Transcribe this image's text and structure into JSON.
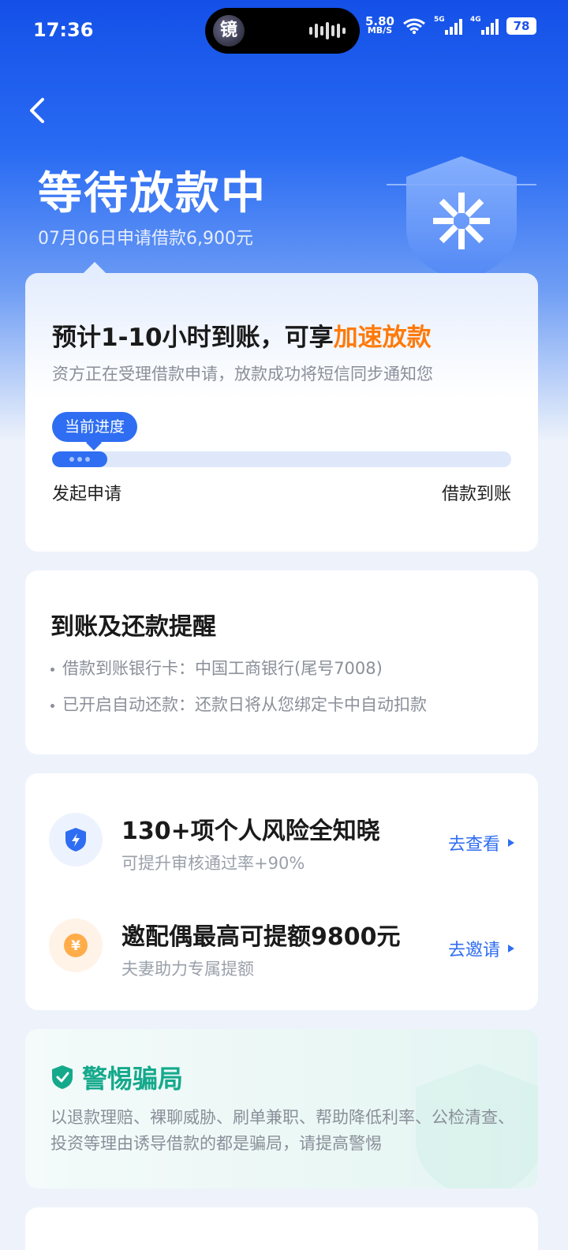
{
  "status_bar": {
    "time": "17:36",
    "island_avatar_text": "镜",
    "net_speed_value": "5.80",
    "net_speed_unit": "MB/S",
    "signal_1_tag": "5G",
    "signal_2_tag": "4G",
    "battery": "78"
  },
  "header": {
    "title": "等待放款中",
    "subtitle": "07月06日申请借款6,900元"
  },
  "progress_card": {
    "eta_prefix": "预计1-10小时到账，可享",
    "eta_accent": "加速放款",
    "description": "资方正在受理借款申请，放款成功将短信同步通知您",
    "bubble_label": "当前进度",
    "progress_fraction": 0.12,
    "start_label": "发起申请",
    "end_label": "借款到账"
  },
  "reminder_card": {
    "title": "到账及还款提醒",
    "items": [
      "借款到账银行卡：中国工商银行(尾号7008)",
      "已开启自动还款：还款日将从您绑定卡中自动扣款"
    ]
  },
  "offers": [
    {
      "title": "130+项个人风险全知晓",
      "subtitle": "可提升审核通过率+90%",
      "action": "去查看",
      "icon": "lightning-shield-icon"
    },
    {
      "title": "邀配偶最高可提额9800元",
      "subtitle": "夫妻助力专属提额",
      "action": "去邀请",
      "icon": "yuan-coin-icon"
    }
  ],
  "fraud_card": {
    "title": "警惕骗局",
    "text": "以退款理赔、裸聊威胁、刷单兼职、帮助降低利率、公检清查、投资等理由诱导借款的都是骗局，请提高警惕"
  },
  "colors": {
    "brand_blue": "#2f6ef2",
    "accent_orange": "#ff7a0a",
    "fraud_green": "#15a98c"
  }
}
